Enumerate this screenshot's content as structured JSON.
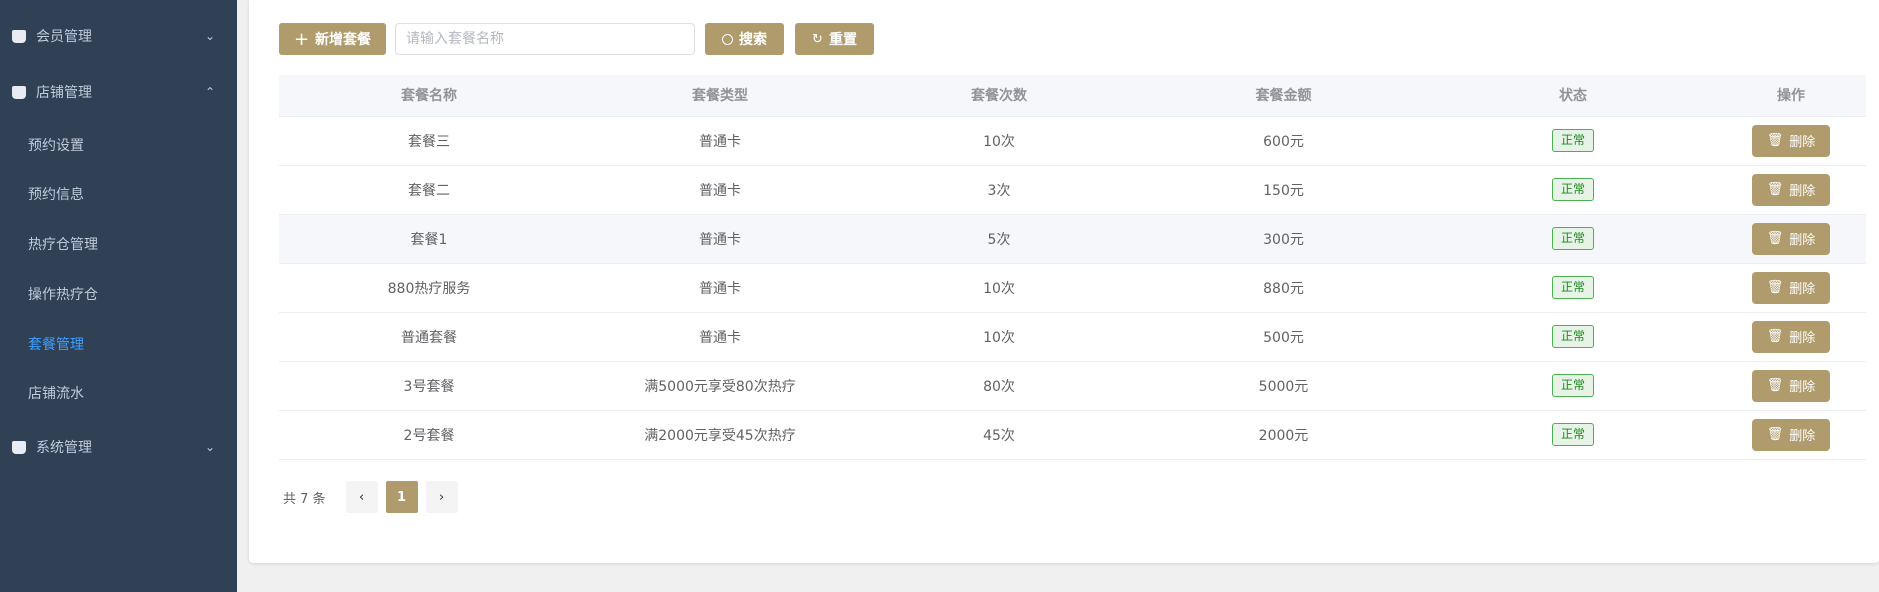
{
  "sidebar": {
    "items": [
      {
        "label": "会员管理",
        "type": "group",
        "chevron": "⌄"
      },
      {
        "label": "店铺管理",
        "type": "group",
        "chevron": "⌃"
      },
      {
        "label": "预约设置",
        "type": "sub"
      },
      {
        "label": "预约信息",
        "type": "sub"
      },
      {
        "label": "热疗仓管理",
        "type": "sub"
      },
      {
        "label": "操作热疗仓",
        "type": "sub"
      },
      {
        "label": "套餐管理",
        "type": "sub",
        "active": true
      },
      {
        "label": "店铺流水",
        "type": "sub"
      },
      {
        "label": "系统管理",
        "type": "group",
        "chevron": "⌄"
      }
    ],
    "active_color": "#409eff"
  },
  "toolbar": {
    "add_label": "新增套餐",
    "search_placeholder": "请输入套餐名称",
    "search_value": "",
    "search_label": "搜索",
    "reset_label": "重置",
    "accent": "#b09b6d"
  },
  "table": {
    "columns": [
      "套餐名称",
      "套餐类型",
      "套餐次数",
      "套餐金额",
      "状态",
      "操作"
    ],
    "rows": [
      [
        "套餐三",
        "普通卡",
        "10次",
        "600元",
        "正常",
        "删除"
      ],
      [
        "套餐二",
        "普通卡",
        "3次",
        "150元",
        "正常",
        "删除"
      ],
      [
        "套餐1",
        "普通卡",
        "5次",
        "300元",
        "正常",
        "删除"
      ],
      [
        "880热疗服务",
        "普通卡",
        "10次",
        "880元",
        "正常",
        "删除"
      ],
      [
        "普通套餐",
        "普通卡",
        "10次",
        "500元",
        "正常",
        "删除"
      ],
      [
        "3号套餐",
        "满5000元享受80次热疗",
        "80次",
        "5000元",
        "正常",
        "删除"
      ],
      [
        "2号套餐",
        "满2000元享受45次热疗",
        "45次",
        "2000元",
        "正常",
        "删除"
      ]
    ]
  },
  "pagination": {
    "total": "共 7 条",
    "prev": "‹",
    "current": "1",
    "next": "›"
  }
}
